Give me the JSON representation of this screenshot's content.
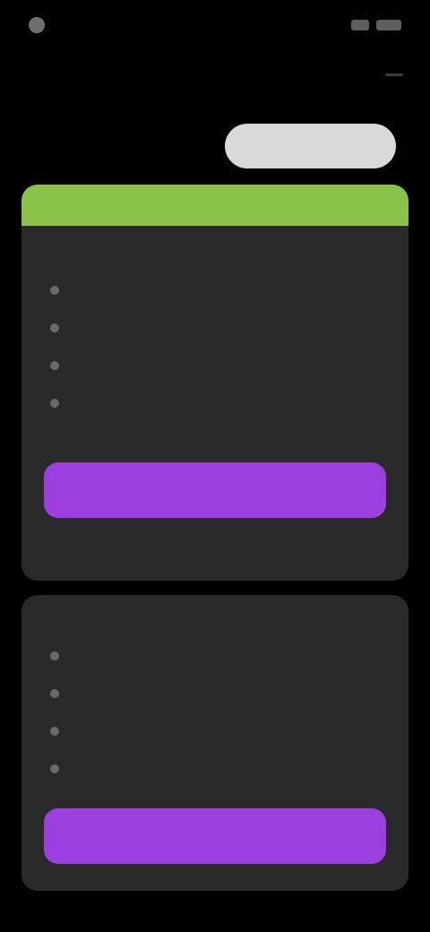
{
  "status_bar": {
    "time": ""
  },
  "header": {
    "title": ""
  },
  "segmented": {
    "tabs": [
      {
        "label": ""
      },
      {
        "label": ""
      }
    ]
  },
  "plans": [
    {
      "banner": "",
      "name": "",
      "price": "",
      "note": "",
      "features": [
        "",
        "",
        "",
        ""
      ],
      "fine_print": "",
      "cta": ""
    },
    {
      "name": "",
      "price": "",
      "features": [
        "",
        "",
        "",
        ""
      ],
      "cta": ""
    }
  ],
  "colors": {
    "background": "#000000",
    "card": "#2a2a2a",
    "accent_green": "#8bc34a",
    "cta_purple": "#9d3fe0",
    "tab_active": "#d9d9d9"
  },
  "icons": {
    "status_left": "signal-dot-icon",
    "header_right": "menu-icon"
  }
}
